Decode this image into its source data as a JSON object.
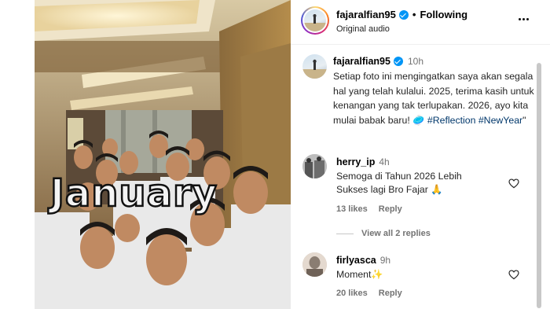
{
  "post": {
    "username": "fajaralfian95",
    "follow_status": "Following",
    "audio": "Original audio",
    "separator": "•"
  },
  "caption": {
    "username": "fajaralfian95",
    "time": "10h",
    "text_main": "Setiap foto ini mengingatkan saya akan segala hal yang telah kulalui. 2025, terima kasih untuk kenangan yang tak terlupakan. 2026, ayo kita mulai babak baru! 🥏 ",
    "hashtags": "#Reflection #NewYear",
    "text_end": "\""
  },
  "comments": [
    {
      "username": "herry_ip",
      "time": "4h",
      "text": "Semoga di Tahun 2026 Lebih Sukses lagi Bro Fajar 🙏",
      "likes": "13 likes",
      "reply": "Reply"
    },
    {
      "username": "firlyasca",
      "time": "9h",
      "text": "Moment✨",
      "likes": "20 likes",
      "reply": "Reply"
    }
  ],
  "view_replies": "View all 2 replies",
  "media": {
    "overlay_text": "January"
  },
  "colors": {
    "link": "#00376b",
    "verified": "#0095f6",
    "muted": "#737373"
  }
}
